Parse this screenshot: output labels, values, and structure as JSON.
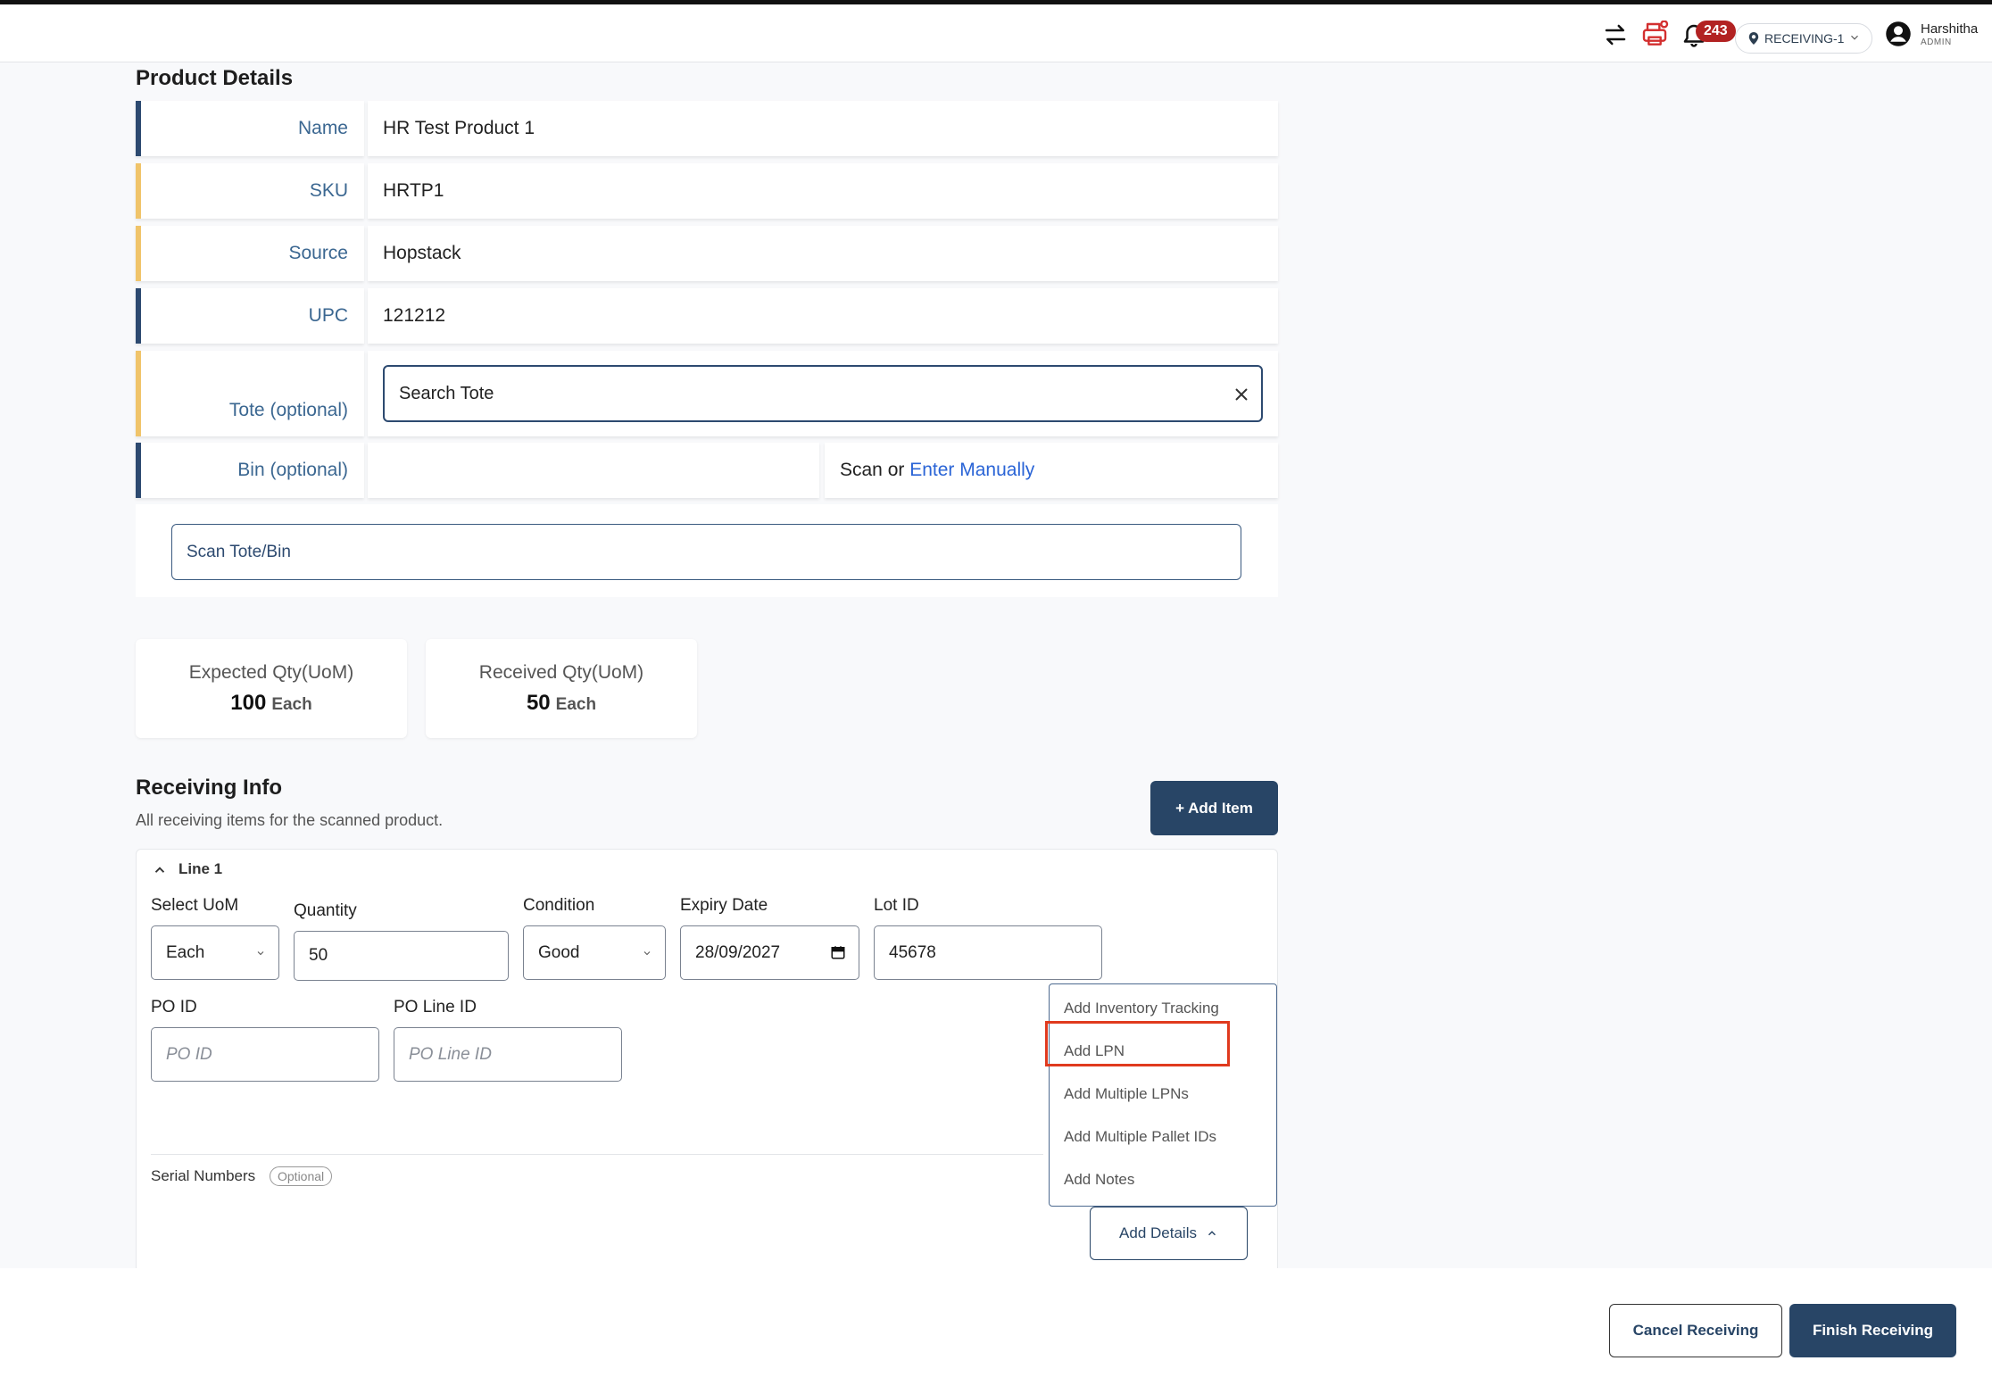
{
  "header": {
    "notification_count": "243",
    "warehouse": "RECEIVING-1",
    "user_name": "Harshitha",
    "user_role": "ADMIN",
    "colors": {
      "printer": "#d32f2f",
      "badge": "#b22222"
    }
  },
  "product": {
    "title": "Product Details",
    "rows": [
      {
        "label": "Name",
        "value": "HR Test Product 1"
      },
      {
        "label": "SKU",
        "value": "HRTP1"
      },
      {
        "label": "Source",
        "value": "Hopstack"
      },
      {
        "label": "UPC",
        "value": "121212"
      }
    ],
    "tote_label": "Tote (optional)",
    "tote_placeholder": "Search Tote",
    "bin_label": "Bin (optional)",
    "bin_scan_text": "Scan or",
    "bin_enter_link": "Enter Manually",
    "scan_placeholder": "Scan Tote/Bin"
  },
  "quantities": {
    "expected_label": "Expected Qty(UoM)",
    "expected_value": "100",
    "expected_unit": "Each",
    "received_label": "Received Qty(UoM)",
    "received_value": "50",
    "received_unit": "Each"
  },
  "receiving": {
    "title": "Receiving Info",
    "subtitle": "All receiving items for the scanned product.",
    "add_item": "+ Add Item",
    "line_title": "Line 1",
    "uom_label": "Select UoM",
    "uom_value": "Each",
    "quantity_label": "Quantity",
    "quantity_value": "50",
    "condition_label": "Condition",
    "condition_value": "Good",
    "expiry_label": "Expiry Date",
    "expiry_value": "28/09/2027",
    "lot_label": "Lot ID",
    "lot_value": "45678",
    "po_label": "PO ID",
    "po_placeholder": "PO ID",
    "po_line_label": "PO Line ID",
    "po_line_placeholder": "PO Line ID",
    "serial_label": "Serial Numbers",
    "serial_badge": "Optional",
    "add_details": "Add Details",
    "menu": [
      "Add Inventory Tracking",
      "Add LPN",
      "Add Multiple LPNs",
      "Add Multiple Pallet IDs",
      "Add Notes"
    ]
  },
  "footer": {
    "cancel": "Cancel Receiving",
    "finish": "Finish Receiving"
  }
}
